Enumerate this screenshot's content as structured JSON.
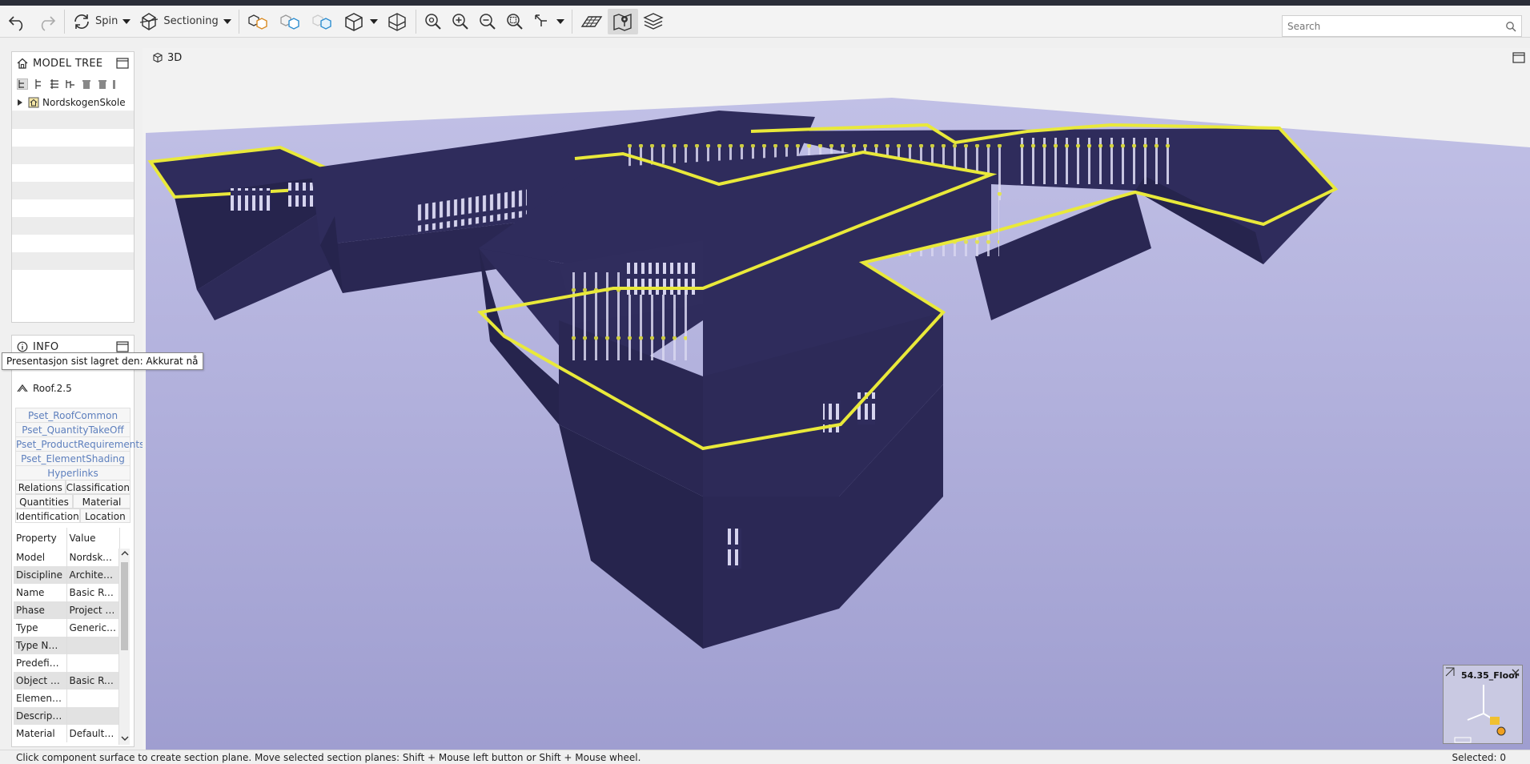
{
  "toolbar": {
    "spin_label": "Spin",
    "sectioning_label": "Sectioning",
    "search_placeholder": "Search"
  },
  "model_tree": {
    "title": "MODEL TREE",
    "root_item": "NordskogenSkole"
  },
  "info": {
    "title": "INFO",
    "tooltip": "Presentasjon sist lagret den: Akkurat nå",
    "selected_object": "Roof.2.5",
    "psets": [
      "Pset_RoofCommon",
      "Pset_QuantityTakeOff",
      "Pset_ProductRequirements",
      "Pset_ElementShading",
      "Hyperlinks"
    ],
    "tabs_row1": [
      "Relations",
      "Classification"
    ],
    "tabs_row2": [
      "Quantities",
      "Material"
    ],
    "tabs_row3": [
      "Identification",
      "Location"
    ],
    "table_header": [
      "Property",
      "Value"
    ],
    "rows": [
      {
        "property": "Model",
        "value": "Nordskog..."
      },
      {
        "property": "Discipline",
        "value": "Architect..."
      },
      {
        "property": "Name",
        "value": "Basic Roo..."
      },
      {
        "property": "Phase",
        "value": "Project St..."
      },
      {
        "property": "Type",
        "value": "Generic R..."
      },
      {
        "property": "Type Name",
        "value": ""
      },
      {
        "property": "Predefine...",
        "value": ""
      },
      {
        "property": "Object Type",
        "value": "Basic Roo..."
      },
      {
        "property": "Element T...",
        "value": ""
      },
      {
        "property": "Description",
        "value": ""
      },
      {
        "property": "Material",
        "value": "Default R..."
      }
    ]
  },
  "view": {
    "label": "3D",
    "floor_label": "54.35_Floor"
  },
  "colors": {
    "building": "#2f2c5c",
    "building_side": "#26244d",
    "ground": "#b8b7df",
    "highlight": "#e9e93a"
  },
  "status": {
    "hint": "Click component surface to create section plane. Move selected section planes: Shift + Mouse left button or Shift + Mouse wheel.",
    "selected": "Selected: 0"
  }
}
